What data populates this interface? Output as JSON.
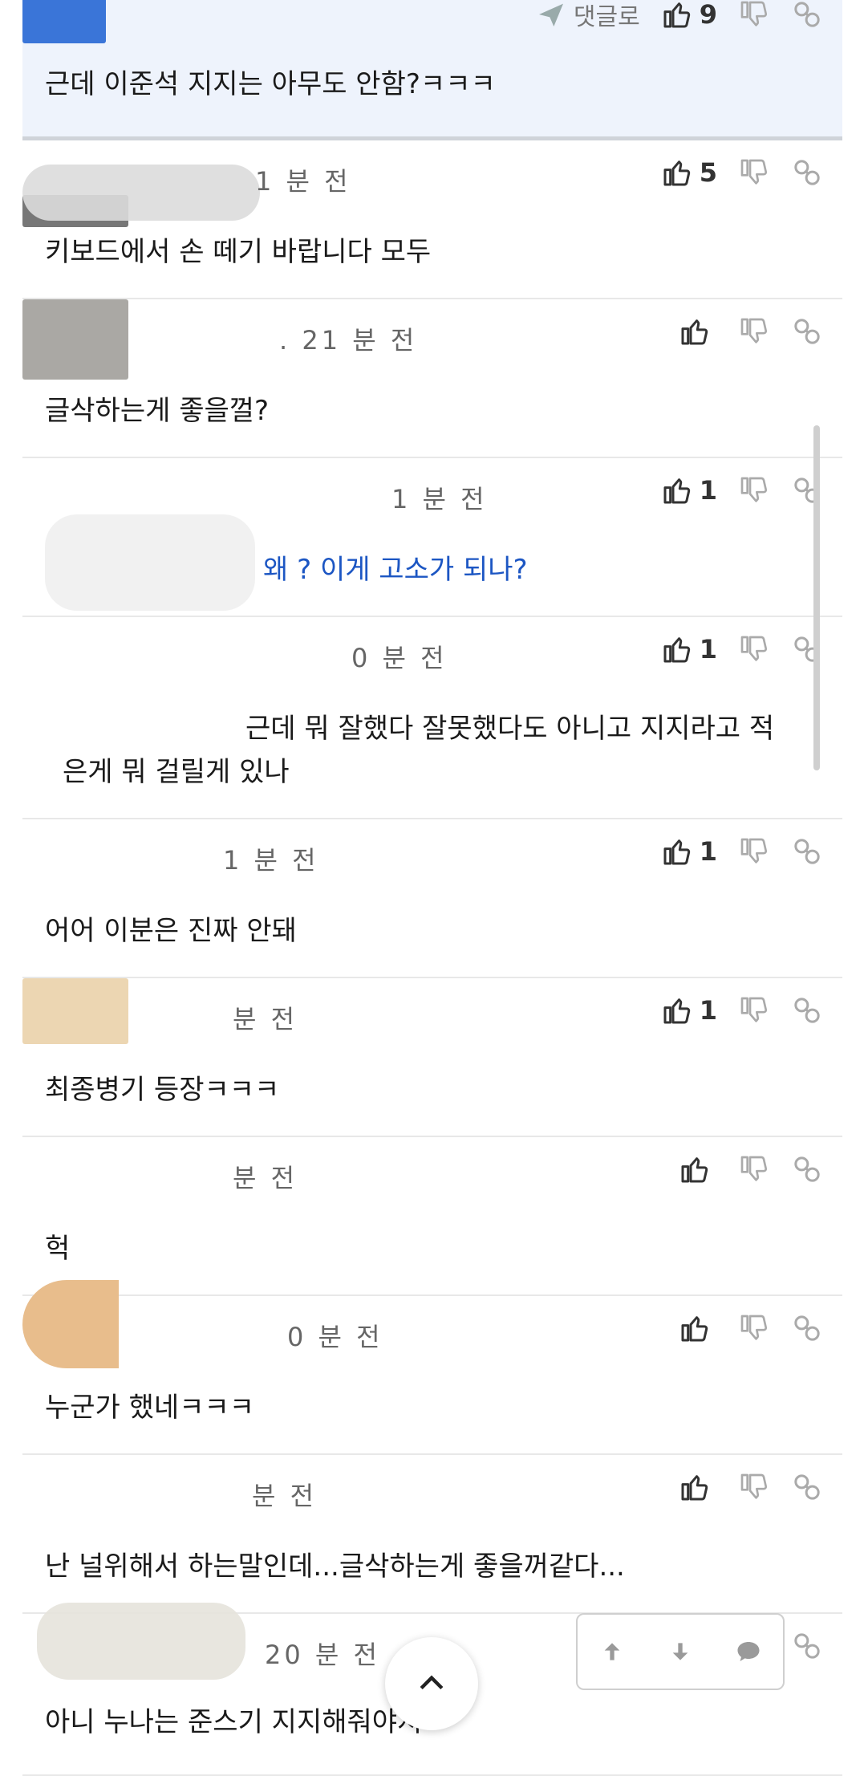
{
  "comments": [
    {
      "time": "",
      "reply": "댓글로",
      "likes": "9",
      "text": "근데 이준석 지지는 아무도 안함?ㅋㅋㅋ"
    },
    {
      "time": "1 분 전",
      "reply": "",
      "likes": "5",
      "text": "키보드에서 손 떼기 바랍니다 모두"
    },
    {
      "time": ". 21 분 전",
      "reply": "",
      "likes": "",
      "text": "글삭하는게 좋을껄?"
    },
    {
      "time": "1 분 전",
      "reply": "",
      "likes": "1",
      "text": "왜 ? 이게 고소가 되나?"
    },
    {
      "time": "0 분 전",
      "reply": "",
      "likes": "1",
      "text": "근데 뭐 잘했다 잘못했다도 아니고 지지라고 적",
      "text2": "은게 뭐 걸릴게 있나"
    },
    {
      "time": "1 분 전",
      "reply": "",
      "likes": "1",
      "text": "어어 이분은 진짜 안돼"
    },
    {
      "time": "분 전",
      "reply": "",
      "likes": "1",
      "text": "최종병기 등장ㅋㅋㅋ"
    },
    {
      "time": "분 전",
      "reply": "",
      "likes": "",
      "text": "헉"
    },
    {
      "time": "0 분 전",
      "reply": "",
      "likes": "",
      "text": "누군가 했네ㅋㅋㅋ"
    },
    {
      "time": "분 전",
      "reply": "",
      "likes": "",
      "text": "난 널위해서 하는말인데...글삭하는게 좋을꺼같다..."
    },
    {
      "time": "20 분 전",
      "reply": "",
      "likes": "",
      "text": "아니 누나는 준스기 지지해줘야지"
    }
  ],
  "icons": {
    "like": "thumbs-up-icon",
    "dislike": "thumbs-down-icon",
    "link": "link-icon",
    "reply": "reply-arrow-icon",
    "up": "arrow-up-icon",
    "down": "arrow-down-icon",
    "chat": "chat-bubble-icon",
    "top": "chevron-up-icon"
  },
  "colors": {
    "accent": "#1c56c3",
    "first_bg": "#eef3fc"
  }
}
